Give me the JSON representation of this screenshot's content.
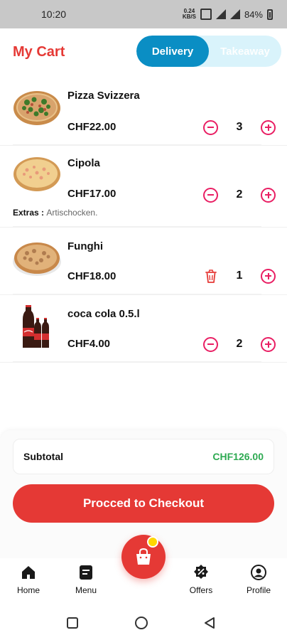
{
  "status_bar": {
    "time": "10:20",
    "net_speed_top": "0.24",
    "net_speed_bottom": "KB/S",
    "battery": "84%"
  },
  "header": {
    "title": "My Cart",
    "tab_delivery": "Delivery",
    "tab_takeaway": "Takeaway",
    "active_tab": "Delivery",
    "accent_color": "#e53935",
    "tab_active_color": "#0a8ec4"
  },
  "cart": {
    "items": [
      {
        "name": "Pizza Svizzera",
        "price": "CHF22.00",
        "quantity": "3",
        "image": "pizza-svizzera",
        "left_control": "minus"
      },
      {
        "name": "Cipola",
        "price": "CHF17.00",
        "quantity": "2",
        "image": "pizza-cipola",
        "left_control": "minus",
        "extras_label": "Extras :",
        "extras_value": "Artischocken."
      },
      {
        "name": "Funghi",
        "price": "CHF18.00",
        "quantity": "1",
        "image": "pizza-funghi",
        "left_control": "trash"
      },
      {
        "name": "coca cola 0.5.l",
        "price": "CHF4.00",
        "quantity": "2",
        "image": "coca-cola-bottles",
        "left_control": "minus"
      }
    ]
  },
  "summary": {
    "subtotal_label": "Subtotal",
    "subtotal_value": "CHF126.00",
    "subtotal_color": "#2eaa52",
    "checkout_label": "Procced to Checkout"
  },
  "bottom_nav": {
    "items": [
      {
        "label": "Home",
        "icon": "home-icon"
      },
      {
        "label": "Menu",
        "icon": "menu-icon"
      },
      {
        "label": "Offers",
        "icon": "offers-icon"
      },
      {
        "label": "Profile",
        "icon": "profile-icon"
      }
    ],
    "center_icon": "cart-bag-icon"
  }
}
